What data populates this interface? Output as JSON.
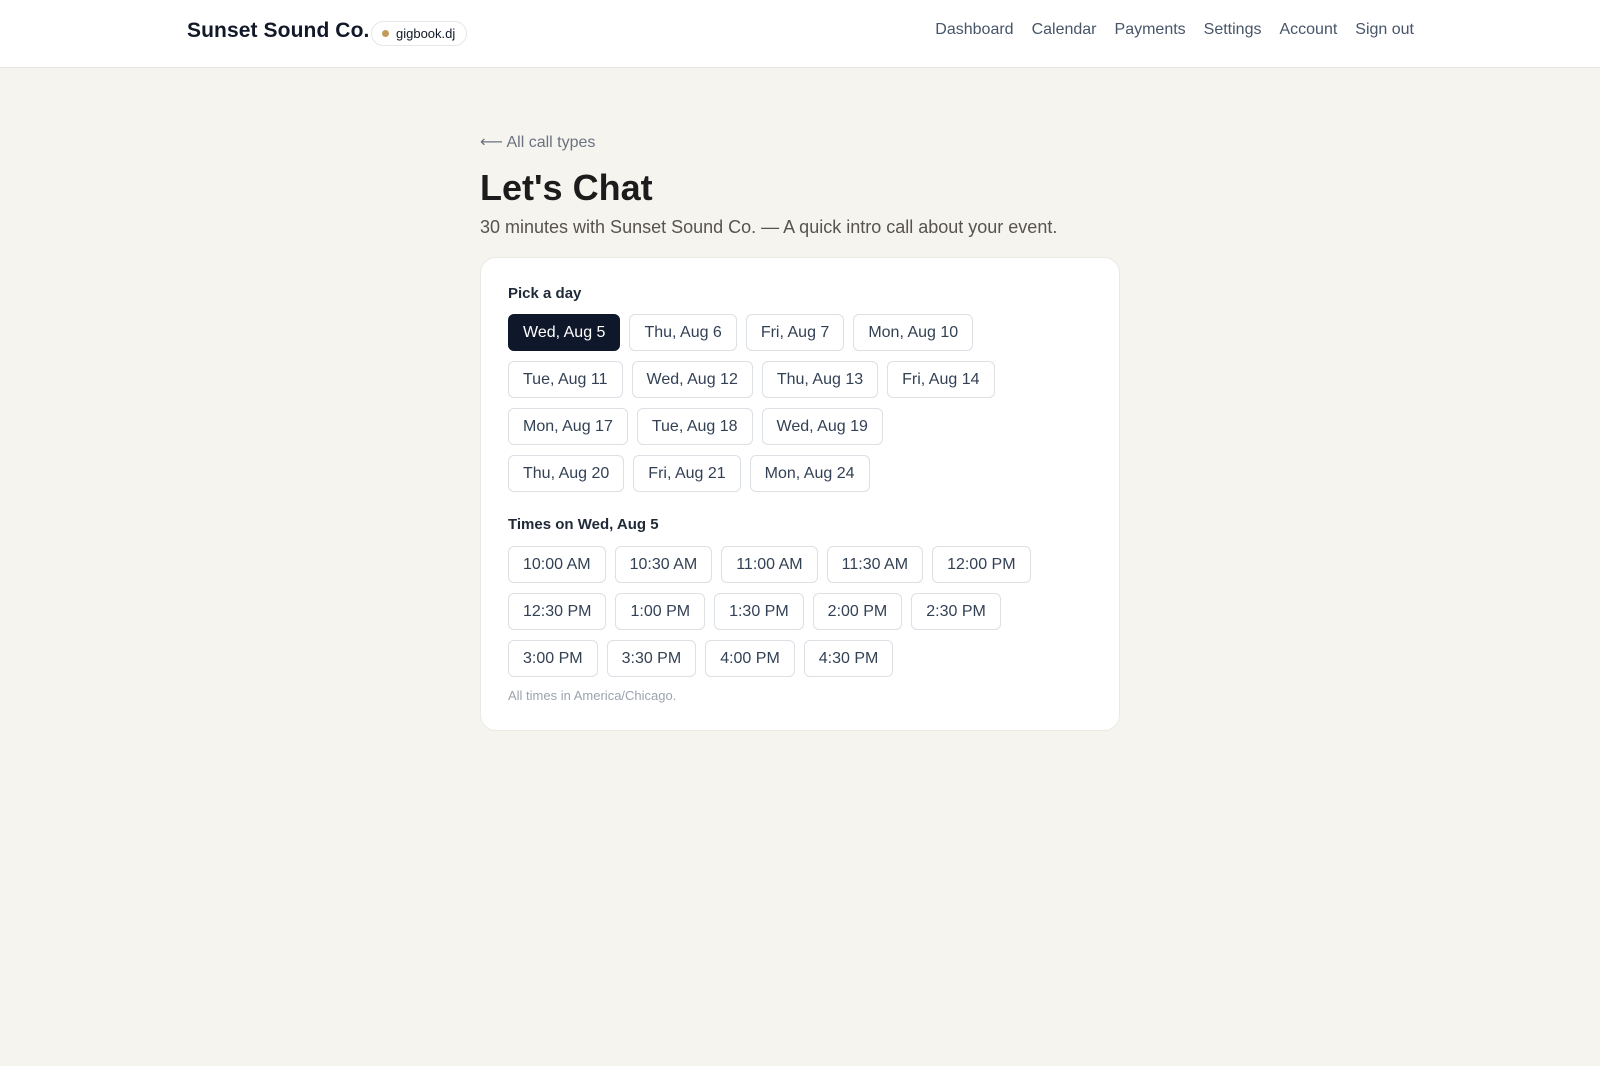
{
  "header": {
    "brand": "Sunset Sound Co.",
    "domain_badge": "gigbook.dj",
    "nav": [
      "Dashboard",
      "Calendar",
      "Payments",
      "Settings",
      "Account",
      "Sign out"
    ]
  },
  "page": {
    "back_link": "⟵ All call types",
    "title": "Let's Chat",
    "subtitle": "30 minutes with Sunset Sound Co. — A quick intro call about your event."
  },
  "day_picker": {
    "label": "Pick a day",
    "selected_index": 0,
    "days": [
      "Wed, Aug 5",
      "Thu, Aug 6",
      "Fri, Aug 7",
      "Mon, Aug 10",
      "Tue, Aug 11",
      "Wed, Aug 12",
      "Thu, Aug 13",
      "Fri, Aug 14",
      "Mon, Aug 17",
      "Tue, Aug 18",
      "Wed, Aug 19",
      "Thu, Aug 20",
      "Fri, Aug 21",
      "Mon, Aug 24"
    ]
  },
  "time_picker": {
    "label": "Times on Wed, Aug 5",
    "times": [
      "10:00 AM",
      "10:30 AM",
      "11:00 AM",
      "11:30 AM",
      "12:00 PM",
      "12:30 PM",
      "1:00 PM",
      "1:30 PM",
      "2:00 PM",
      "2:30 PM",
      "3:00 PM",
      "3:30 PM",
      "4:00 PM",
      "4:30 PM"
    ],
    "timezone_note": "All times in America/Chicago."
  },
  "colors": {
    "background": "#f5f4ef",
    "selected_chip": "#0f172a",
    "badge_dot": "#c49a5a"
  }
}
